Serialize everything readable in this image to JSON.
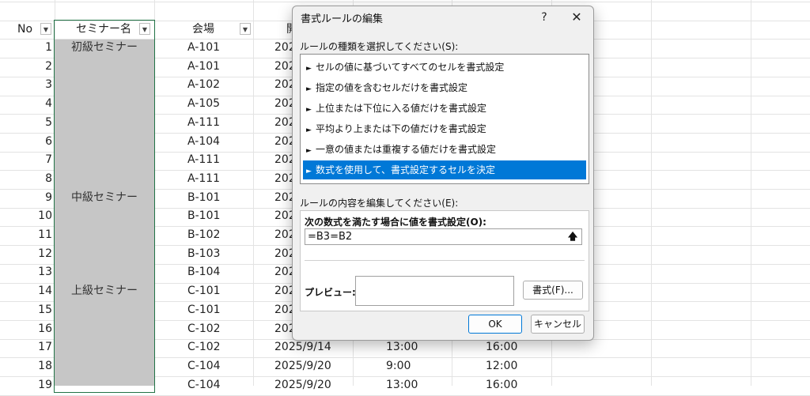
{
  "columns": {
    "no": "No",
    "seminar": "セミナー名",
    "venue": "会場",
    "start_partial": "開"
  },
  "rows": [
    {
      "no": "1",
      "seminar": "初級セミナー",
      "venue": "A-101",
      "date": "202"
    },
    {
      "no": "2",
      "seminar": "",
      "venue": "A-101",
      "date": "202"
    },
    {
      "no": "3",
      "seminar": "",
      "venue": "A-102",
      "date": "202"
    },
    {
      "no": "4",
      "seminar": "",
      "venue": "A-105",
      "date": "202"
    },
    {
      "no": "5",
      "seminar": "",
      "venue": "A-111",
      "date": "202"
    },
    {
      "no": "6",
      "seminar": "",
      "venue": "A-104",
      "date": "202"
    },
    {
      "no": "7",
      "seminar": "",
      "venue": "A-111",
      "date": "202"
    },
    {
      "no": "8",
      "seminar": "",
      "venue": "A-111",
      "date": "202"
    },
    {
      "no": "9",
      "seminar": "中級セミナー",
      "venue": "B-101",
      "date": "202"
    },
    {
      "no": "10",
      "seminar": "",
      "venue": "B-101",
      "date": "202"
    },
    {
      "no": "11",
      "seminar": "",
      "venue": "B-102",
      "date": "202"
    },
    {
      "no": "12",
      "seminar": "",
      "venue": "B-103",
      "date": "202"
    },
    {
      "no": "13",
      "seminar": "",
      "venue": "B-104",
      "date": "202"
    },
    {
      "no": "14",
      "seminar": "上級セミナー",
      "venue": "C-101",
      "date": "202"
    },
    {
      "no": "15",
      "seminar": "",
      "venue": "C-101",
      "date": "202"
    },
    {
      "no": "16",
      "seminar": "",
      "venue": "C-102",
      "date": "202"
    },
    {
      "no": "17",
      "seminar": "",
      "venue": "C-102",
      "date": "2025/9/14",
      "start": "13:00",
      "end": "16:00"
    },
    {
      "no": "18",
      "seminar": "",
      "venue": "C-104",
      "date": "2025/9/20",
      "start": "9:00",
      "end": "12:00"
    },
    {
      "no": "19",
      "seminar": "",
      "venue": "C-104",
      "date": "2025/9/20",
      "start": "13:00",
      "end": "16:00"
    }
  ],
  "dialog": {
    "title": "書式ルールの編集",
    "help": "?",
    "close": "✕",
    "rule_type_label": "ルールの種類を選択してください(S):",
    "rule_types": [
      "セルの値に基づいてすべてのセルを書式設定",
      "指定の値を含むセルだけを書式設定",
      "上位または下位に入る値だけを書式設定",
      "平均より上または下の値だけを書式設定",
      "一意の値または重複する値だけを書式設定",
      "数式を使用して、書式設定するセルを決定"
    ],
    "selected_index": 5,
    "rule_content_label": "ルールの内容を編集してください(E):",
    "formula_label": "次の数式を満たす場合に値を書式設定(O):",
    "formula_value": "=B3=B2",
    "preview_label": "プレビュー:",
    "format_button": "書式(F)...",
    "ok_button": "OK",
    "cancel_button": "キャンセル"
  },
  "colors": {
    "selection_blue": "#0078d7",
    "range_fill_gray": "#c6c6c6",
    "selection_border_green": "#217346"
  }
}
